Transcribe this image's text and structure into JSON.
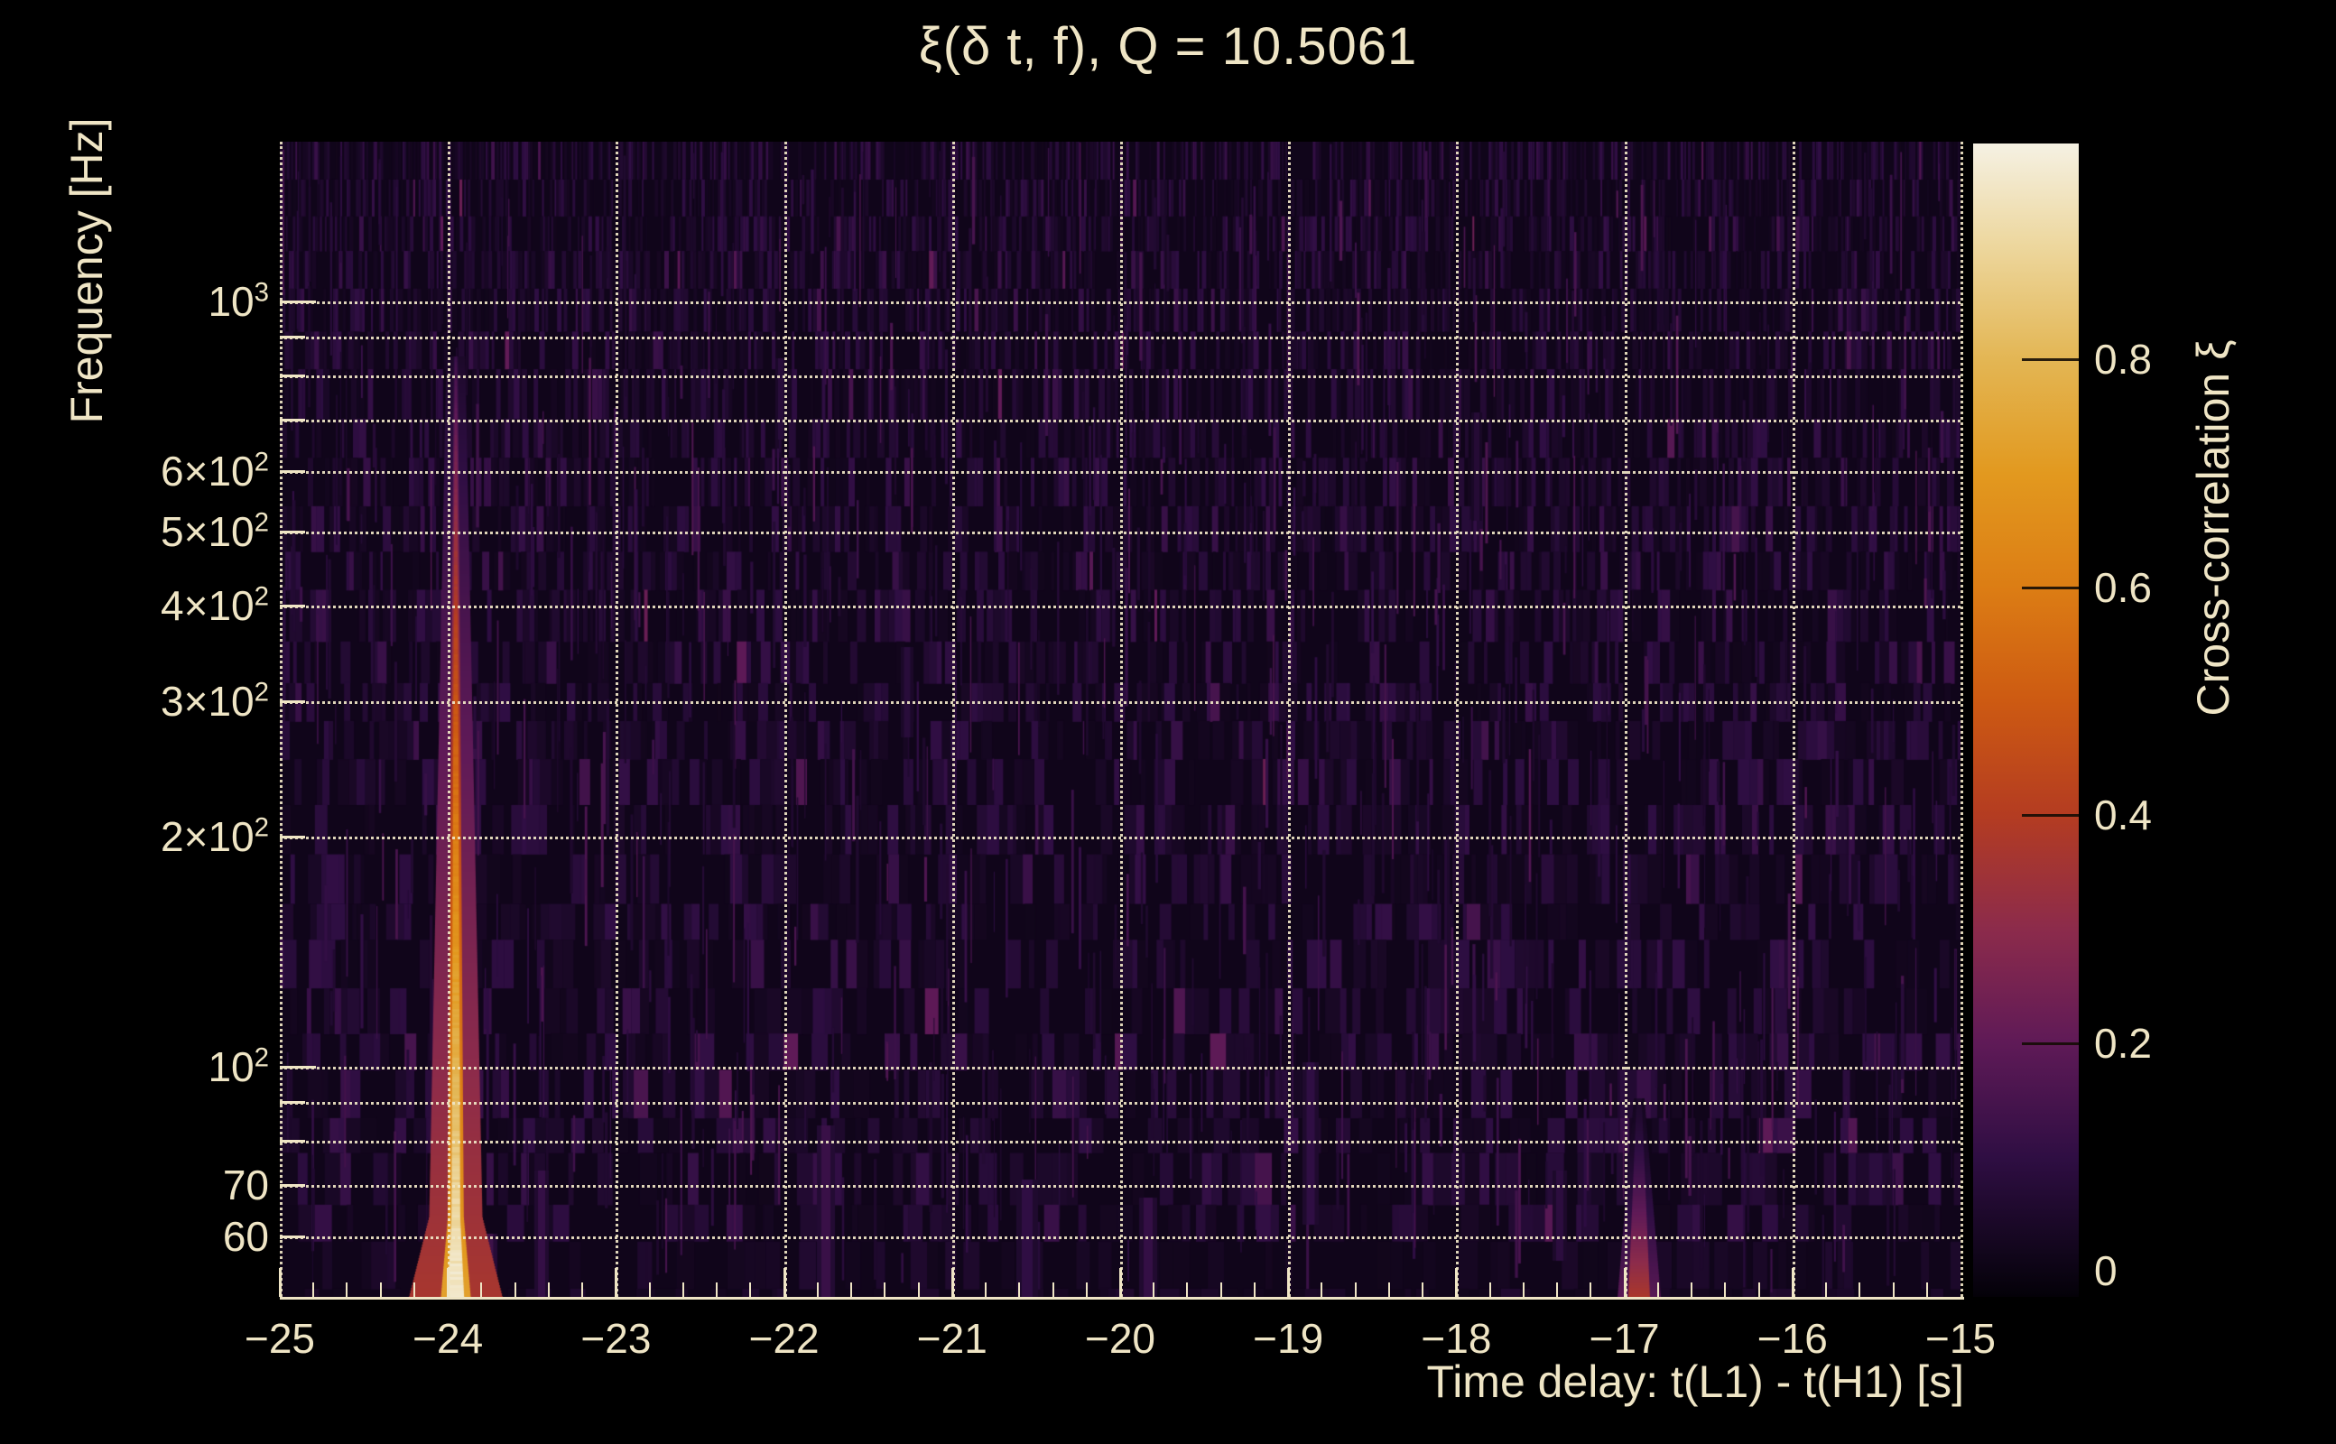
{
  "title": "ξ(δ t, f), Q = 10.5061",
  "colors": {
    "background": "#000000",
    "text_cream": "#efe5c5",
    "grid": "#f0e6c6",
    "plot_background": "#0a0312",
    "colormap_stops": [
      "#0c0414",
      "#2f0e43",
      "#5f1a57",
      "#8c2b4b",
      "#b43c21",
      "#cd5a12",
      "#dc7d14",
      "#e2991f",
      "#e3b654",
      "#edd79e",
      "#f5f1e3"
    ]
  },
  "x_axis": {
    "label": "Time delay: t(L1) - t(H1) [s]",
    "ticks": [
      {
        "v": -25,
        "label": "−25"
      },
      {
        "v": -24,
        "label": "−24"
      },
      {
        "v": -23,
        "label": "−23"
      },
      {
        "v": -22,
        "label": "−22"
      },
      {
        "v": -21,
        "label": "−21"
      },
      {
        "v": -20,
        "label": "−20"
      },
      {
        "v": -19,
        "label": "−19"
      },
      {
        "v": -18,
        "label": "−18"
      },
      {
        "v": -17,
        "label": "−17"
      },
      {
        "v": -16,
        "label": "−16"
      },
      {
        "v": -15,
        "label": "−15"
      }
    ],
    "minor_step": 0.2
  },
  "y_axis": {
    "label": "Frequency [Hz]",
    "scale": "log",
    "labeled_ticks": [
      {
        "f": 1000,
        "label": "10^3"
      },
      {
        "f": 600,
        "label": "6×10^2"
      },
      {
        "f": 500,
        "label": "5×10^2"
      },
      {
        "f": 400,
        "label": "4×10^2"
      },
      {
        "f": 300,
        "label": "3×10^2"
      },
      {
        "f": 200,
        "label": "2×10^2"
      },
      {
        "f": 100,
        "label": "10^2"
      },
      {
        "f": 70,
        "label": "70"
      },
      {
        "f": 60,
        "label": "60"
      }
    ],
    "gridline_freqs": [
      60,
      70,
      80,
      90,
      100,
      200,
      300,
      400,
      500,
      600,
      700,
      800,
      900,
      1000
    ]
  },
  "colorbar": {
    "label": "Cross-correlation ξ",
    "ticks": [
      {
        "v": 0.8,
        "label": "0.8"
      },
      {
        "v": 0.6,
        "label": "0.6"
      },
      {
        "v": 0.4,
        "label": "0.4"
      },
      {
        "v": 0.2,
        "label": "0.2"
      },
      {
        "v": 0.0,
        "label": "0"
      }
    ]
  },
  "chart_data": {
    "type": "heatmap",
    "title": "ξ(δ t, f), Q = 10.5061",
    "q_value": 10.5061,
    "xlabel": "Time delay: t(L1) - t(H1) [s]",
    "ylabel": "Frequency [Hz]",
    "colorbar_label": "Cross-correlation ξ",
    "x_range_s": [
      -25,
      -15
    ],
    "y_range_hz": [
      50,
      1617
    ],
    "y_scale": "log",
    "grid": "dotted cream, at every decade and 2-9 subdecade frequency, and every integer second",
    "colorbar_range": [
      -0.02,
      1.0
    ],
    "colorbar_ticks": [
      0,
      0.2,
      0.4,
      0.6,
      0.8
    ],
    "x_ticks": [
      -25,
      -24,
      -23,
      -22,
      -21,
      -20,
      -19,
      -18,
      -17,
      -16,
      -15
    ],
    "y_labeled_ticks_hz": [
      1000,
      600,
      500,
      400,
      300,
      200,
      100,
      70,
      60
    ],
    "features": [
      {
        "name": "primary-correlation-ridge",
        "dt_s": -23.97,
        "freq_span_hz": [
          50,
          700
        ],
        "peak_xi": 0.97,
        "description": "narrow bright vertical ridge over full band, orange with cream-white core, brightest and widest near 50-80 Hz"
      },
      {
        "name": "secondary-magenta-blob",
        "dt_s": -16.93,
        "freq_span_hz": [
          50,
          80
        ],
        "peak_xi": 0.38,
        "description": "faint pink-magenta vertical smudge just right of the -17 s gridline at the bottom of the band"
      },
      {
        "name": "background-noise",
        "xi_range": [
          0,
          0.15
        ],
        "description": "dense faint dark-violet vertical streaks over near-black background, arranged in horizontal rows"
      }
    ]
  }
}
